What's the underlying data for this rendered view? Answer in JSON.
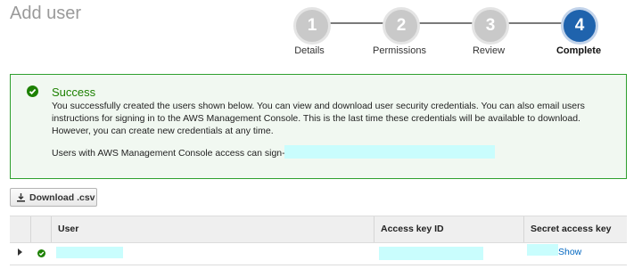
{
  "page": {
    "title": "Add user"
  },
  "stepper": {
    "steps": [
      {
        "number": "1",
        "label": "Details"
      },
      {
        "number": "2",
        "label": "Permissions"
      },
      {
        "number": "3",
        "label": "Review"
      },
      {
        "number": "4",
        "label": "Complete"
      }
    ],
    "active_color": "#1f63ad",
    "inactive_color": "#c9c9c9"
  },
  "success": {
    "title": "Success",
    "message": "You successfully created the users shown below. You can view and download user security credentials. You can also email users instructions for signing in to the AWS Management Console. This is the last time these credentials will be available to download. However, you can create new credentials at any time.",
    "signin_label": "Users with AWS Management Console access can sign-in at:",
    "icon": "check-circle-icon",
    "color": "#1d8102"
  },
  "toolbar": {
    "download_label": "Download .csv",
    "download_icon": "download-icon"
  },
  "table": {
    "columns": [
      "User",
      "Access key ID",
      "Secret access key"
    ],
    "rows": [
      {
        "show_label": "Show"
      }
    ]
  }
}
